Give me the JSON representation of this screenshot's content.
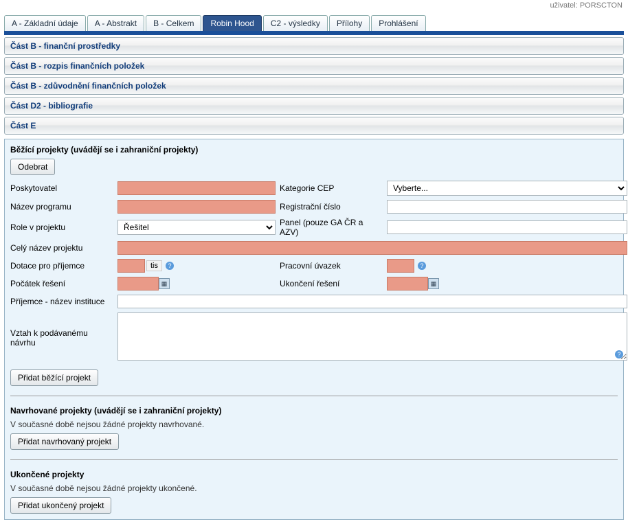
{
  "user_label": "uživatel: PORSCTON",
  "tabs": [
    {
      "label": "A - Základní údaje"
    },
    {
      "label": "A - Abstrakt"
    },
    {
      "label": "B - Celkem"
    },
    {
      "label": "Robin Hood",
      "active": true
    },
    {
      "label": "C2 - výsledky"
    },
    {
      "label": "Přílohy"
    },
    {
      "label": "Prohlášení"
    }
  ],
  "sections": {
    "b_fin": "Část B - finanční prostředky",
    "b_rozpis": "Část B - rozpis finančních položek",
    "b_zduv": "Část B - zdůvodnění finančních položek",
    "d2": "Část D2 - bibliografie",
    "e": "Část E"
  },
  "running": {
    "title": "Běžící projekty (uvádějí se i zahraniční projekty)",
    "remove_btn": "Odebrat",
    "provider": "Poskytovatel",
    "cat_cep": "Kategorie CEP",
    "cat_cep_placeholder": "Vyberte...",
    "program": "Název programu",
    "reg_no": "Registrační číslo",
    "role": "Role v projektu",
    "role_value": "Řešitel",
    "panel": "Panel (pouze GA ČR a AZV)",
    "full_name": "Celý název projektu",
    "grant": "Dotace pro příjemce",
    "grant_unit": "tis",
    "workload": "Pracovní úvazek",
    "start": "Počátek řešení",
    "end": "Ukončení řešení",
    "inst": "Příjemce - název instituce",
    "relation": "Vztah k podávanému návrhu",
    "add_btn": "Přidat běžící projekt"
  },
  "proposed": {
    "title": "Navrhované projekty (uvádějí se i zahraniční projekty)",
    "empty": "V současné době nejsou žádné projekty navrhované.",
    "add_btn": "Přidat navrhovaný projekt"
  },
  "finished": {
    "title": "Ukončené projekty",
    "empty": "V současné době nejsou žádné projekty ukončené.",
    "add_btn": "Přidat ukončený projekt"
  }
}
